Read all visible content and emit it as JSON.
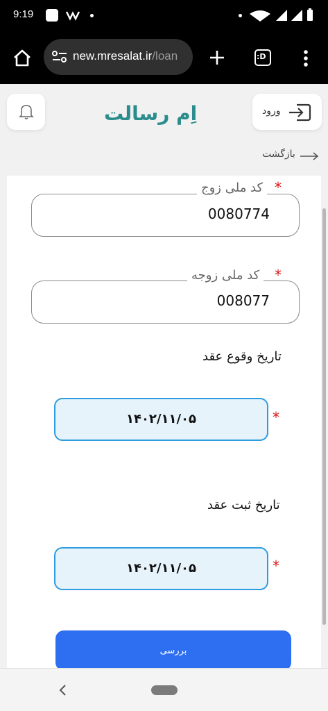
{
  "status_bar": {
    "time": "9:19"
  },
  "browser": {
    "url_host": "new.mresalat.ir",
    "url_path": "/loan",
    "tab_count_label": ":D"
  },
  "header": {
    "logo_text": "اِم رسالت",
    "login_label": "ورود"
  },
  "back_label": "بازگشت",
  "form": {
    "husband_id": {
      "label": "کد ملی زوج",
      "value": "0080774"
    },
    "wife_id": {
      "label": "کد ملی زوجه",
      "value": "008077"
    },
    "marriage_date": {
      "title": "تاریخ وقوع عقد",
      "value": "۱۴۰۲/۱۱/۰۵"
    },
    "registration_date": {
      "title": "تاریخ ثبت عقد",
      "value": "۱۴۰۲/۱۱/۰۵"
    },
    "required_mark": "*",
    "submit_label": "بررسی"
  },
  "colors": {
    "brand": "#2a8c8c",
    "primary_button": "#2e6ff2",
    "date_border": "#2f9be0",
    "date_bg": "#e6f3fb",
    "required": "#dd1111"
  }
}
